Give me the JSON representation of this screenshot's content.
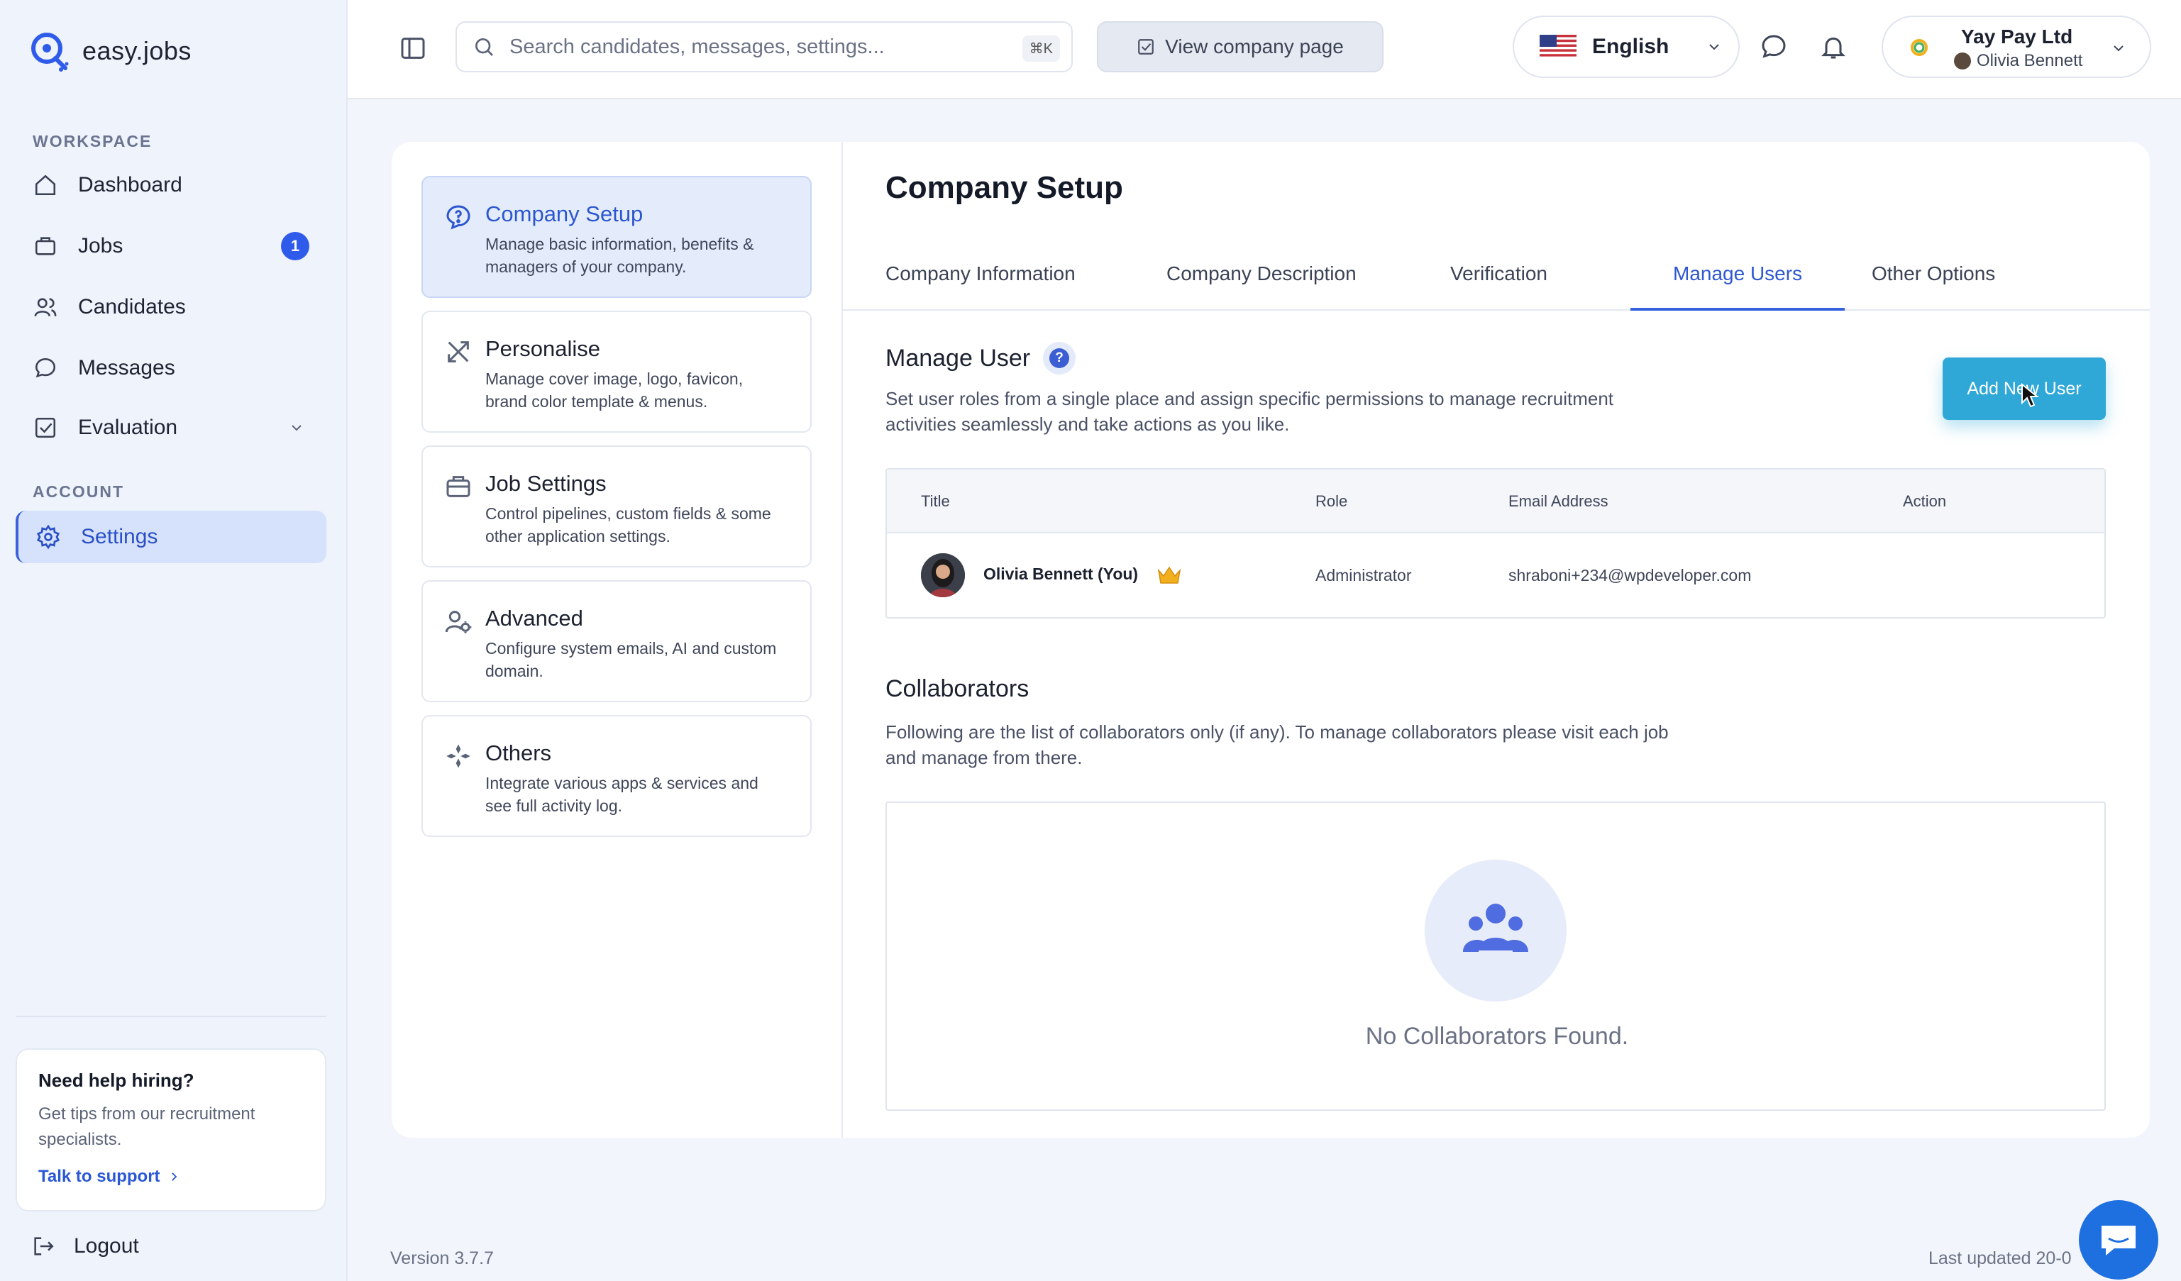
{
  "app": {
    "name": "easy.jobs"
  },
  "sidebar": {
    "workspace_label": "WORKSPACE",
    "account_label": "ACCOUNT",
    "items": [
      {
        "label": "Dashboard"
      },
      {
        "label": "Jobs",
        "badge": "1"
      },
      {
        "label": "Candidates"
      },
      {
        "label": "Messages"
      },
      {
        "label": "Evaluation"
      }
    ],
    "settings_label": "Settings",
    "help": {
      "title": "Need help hiring?",
      "text": "Get tips from our recruitment specialists.",
      "link": "Talk to support"
    },
    "logout": "Logout"
  },
  "topbar": {
    "search_placeholder": "Search candidates, messages, settings...",
    "search_shortcut": "⌘K",
    "view_company": "View company page",
    "language": "English",
    "company_name": "Yay Pay Ltd",
    "user_name": "Olivia Bennett"
  },
  "settings_menu": [
    {
      "title": "Company Setup",
      "desc": "Manage basic information, benefits & managers of your company."
    },
    {
      "title": "Personalise",
      "desc": "Manage cover image, logo, favicon, brand color template & menus."
    },
    {
      "title": "Job Settings",
      "desc": "Control pipelines, custom fields & some other application settings."
    },
    {
      "title": "Advanced",
      "desc": "Configure system emails, AI and custom domain."
    },
    {
      "title": "Others",
      "desc": "Integrate various apps & services and see full activity log."
    }
  ],
  "main": {
    "title": "Company Setup",
    "tabs": [
      "Company Information",
      "Company Description",
      "Verification",
      "Manage Users",
      "Other Options"
    ],
    "active_tab": "Manage Users",
    "manage_user": {
      "title": "Manage User",
      "help_mark": "?",
      "desc": "Set user roles from a single place and assign specific permissions to manage recruitment activities seamlessly and take actions as you like.",
      "add_button": "Add New User",
      "columns": [
        "Title",
        "Role",
        "Email Address",
        "Action"
      ],
      "rows": [
        {
          "name": "Olivia Bennett (You)",
          "role": "Administrator",
          "email": "shraboni+234@wpdeveloper.com"
        }
      ]
    },
    "collaborators": {
      "title": "Collaborators",
      "desc": "Following are the list of collaborators only (if any). To manage collaborators please visit each job and manage from there.",
      "empty": "No Collaborators Found."
    }
  },
  "footer": {
    "version": "Version 3.7.7",
    "last_updated": "Last updated 20-0"
  },
  "colors": {
    "accent": "#3561dd",
    "button": "#2fa8d8",
    "sidebar_bg": "#eef3fc"
  }
}
